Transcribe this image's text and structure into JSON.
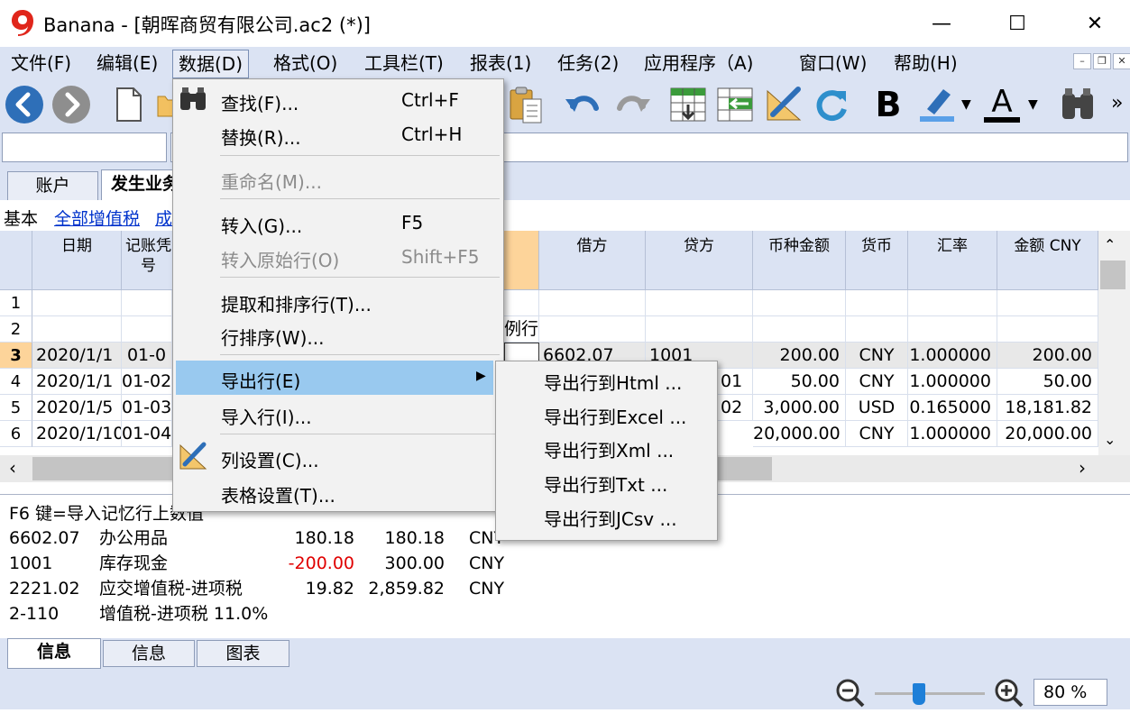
{
  "window": {
    "title": "Banana - [朝晖商贸有限公司.ac2 (*)]",
    "minimize": "—",
    "maximize": "☐",
    "close": "✕"
  },
  "menubar": {
    "items": [
      "文件(F)",
      "编辑(E)",
      "数据(D)",
      "格式(O)",
      "工具栏(T)",
      "报表(1)",
      "任务(2)",
      "应用程序（A)",
      "窗口(W)",
      "帮助(H)"
    ]
  },
  "toolbar": {
    "icons": [
      "back-icon",
      "forward-icon",
      "new-file-icon",
      "open-folder-icon",
      "paste-icon",
      "undo-icon",
      "redo-icon",
      "insert-row-icon",
      "move-row-icon",
      "column-setup-icon",
      "refresh-icon",
      "bold-icon",
      "highlighter-icon",
      "font-color-icon",
      "binoculars-icon"
    ],
    "bold_label": "B",
    "font_color_label": "A",
    "more": "»"
  },
  "tabs": [
    "账户",
    "发生业务"
  ],
  "views": {
    "basic": "基本",
    "all_vat": "全部增值税",
    "other": "成"
  },
  "table": {
    "headers": {
      "date": "日期",
      "voucher": "记账凭\n号",
      "debit": "借方",
      "credit": "贷方",
      "currency_amount": "币种金额",
      "currency": "货币",
      "rate": "汇率",
      "amount_cny": "金额 CNY"
    },
    "rows": [
      {
        "no": "1",
        "date": "",
        "voucher": "",
        "debit": "",
        "credit": "",
        "currency_amount": "",
        "currency": "",
        "rate": "",
        "amount_cny": ""
      },
      {
        "no": "2",
        "date": "",
        "voucher": "",
        "extra": "例行",
        "debit": "",
        "credit": "",
        "currency_amount": "",
        "currency": "",
        "rate": "",
        "amount_cny": ""
      },
      {
        "no": "3",
        "date": "2020/1/1",
        "voucher": "01-0",
        "debit": "6602.07",
        "credit": "1001",
        "currency_amount": "200.00",
        "currency": "CNY",
        "rate": "1.000000",
        "amount_cny": "200.00"
      },
      {
        "no": "4",
        "date": "2020/1/1",
        "voucher": "01-02",
        "debit": "",
        "credit": "01",
        "currency_amount": "50.00",
        "currency": "CNY",
        "rate": "1.000000",
        "amount_cny": "50.00"
      },
      {
        "no": "5",
        "date": "2020/1/5",
        "voucher": "01-03",
        "debit": "",
        "credit": "02",
        "currency_amount": "3,000.00",
        "currency": "USD",
        "rate": "0.165000",
        "amount_cny": "18,181.82"
      },
      {
        "no": "6",
        "date": "2020/1/10",
        "voucher": "01-04",
        "debit": "",
        "credit": "",
        "currency_amount": "20,000.00",
        "currency": "CNY",
        "rate": "1.000000",
        "amount_cny": "20,000.00"
      }
    ]
  },
  "info": {
    "hint": "F6 键=导入记忆行上数值",
    "lines": [
      {
        "account": "6602.07",
        "name": "办公用品",
        "v1": "180.18",
        "v2": "180.18",
        "cur": "CNY"
      },
      {
        "account": "1001",
        "name": "库存现金",
        "v1": "-200.00",
        "v2": "300.00",
        "cur": "CNY"
      },
      {
        "account": "2221.02",
        "name": "应交增值税-进项税",
        "v1": "19.82",
        "v2": "2,859.82",
        "cur": "CNY"
      },
      {
        "account": "2-110",
        "name": "增值税-进项税 11.0%",
        "v1": "",
        "v2": "",
        "cur": ""
      }
    ],
    "negative_color": "#e00000"
  },
  "bottom_tabs": [
    "信息",
    "信息",
    "图表"
  ],
  "status": {
    "zoom": "80 %"
  },
  "data_menu": {
    "find": {
      "label": "查找(F)...",
      "shortcut": "Ctrl+F"
    },
    "replace": {
      "label": "替换(R)...",
      "shortcut": "Ctrl+H"
    },
    "rename": {
      "label": "重命名(M)..."
    },
    "goto": {
      "label": "转入(G)...",
      "shortcut": "F5"
    },
    "goto_original": {
      "label": "转入原始行(O)",
      "shortcut": "Shift+F5"
    },
    "extract_sort": {
      "label": "提取和排序行(T)..."
    },
    "sort_rows": {
      "label": "行排序(W)..."
    },
    "export_rows": {
      "label": "导出行(E)"
    },
    "import_rows": {
      "label": "导入行(I)..."
    },
    "columns_setup": {
      "label": "列设置(C)..."
    },
    "table_setup": {
      "label": "表格设置(T)..."
    }
  },
  "export_submenu": [
    "导出行到Html ...",
    "导出行到Excel ...",
    "导出行到Xml ...",
    "导出行到Txt ...",
    "导出行到JCsv ..."
  ],
  "colors": {
    "accent": "#dbe3f3",
    "menu_highlight": "#99c9ef",
    "row_selected": "#fdd49a"
  }
}
